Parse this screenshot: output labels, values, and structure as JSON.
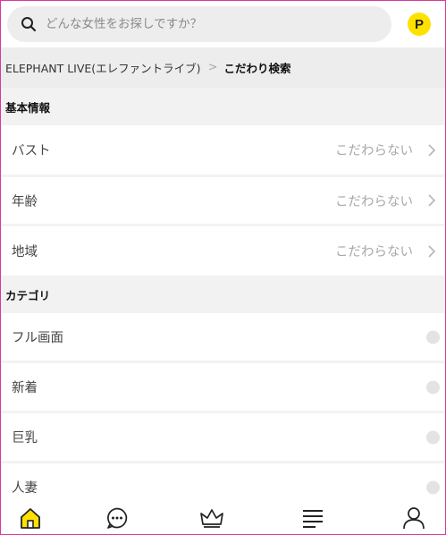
{
  "search": {
    "placeholder": "どんな女性をお探しですか？"
  },
  "header": {
    "points_badge": "P"
  },
  "breadcrumb": {
    "home": "ELEPHANT LIVE(エレファントライブ)",
    "separator": ">",
    "current": "こだわり検索"
  },
  "basic_info": {
    "heading": "基本情報",
    "rows": [
      {
        "label": "バスト",
        "value": "こだわらない"
      },
      {
        "label": "年齢",
        "value": "こだわらない"
      },
      {
        "label": "地域",
        "value": "こだわらない"
      }
    ]
  },
  "category": {
    "heading": "カテゴリ",
    "items": [
      {
        "label": "フル画面"
      },
      {
        "label": "新着"
      },
      {
        "label": "巨乳"
      },
      {
        "label": "人妻"
      }
    ]
  },
  "bottom_nav": {
    "items": [
      "home-icon",
      "chat-icon",
      "crown-icon",
      "list-icon",
      "user-icon"
    ],
    "active_color": "#ffe100"
  }
}
